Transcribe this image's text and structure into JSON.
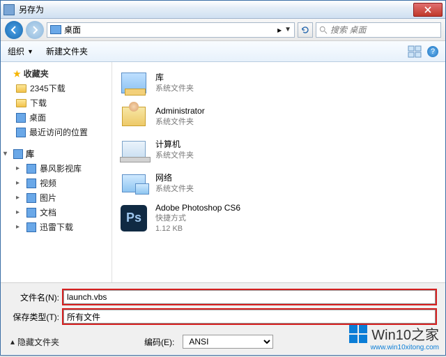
{
  "window": {
    "title": "另存为"
  },
  "nav": {
    "location": "桌面",
    "search_placeholder": "搜索 桌面"
  },
  "toolbar": {
    "organize": "组织",
    "new_folder": "新建文件夹"
  },
  "sidebar": {
    "favorites": {
      "label": "收藏夹",
      "items": [
        "2345下载",
        "下载",
        "桌面",
        "最近访问的位置"
      ]
    },
    "libraries": {
      "label": "库",
      "items": [
        "暴风影视库",
        "视频",
        "图片",
        "文档",
        "迅雷下载"
      ]
    }
  },
  "content": {
    "items": [
      {
        "title": "库",
        "subtitle": "系统文件夹"
      },
      {
        "title": "Administrator",
        "subtitle": "系统文件夹"
      },
      {
        "title": "计算机",
        "subtitle": "系统文件夹"
      },
      {
        "title": "网络",
        "subtitle": "系统文件夹"
      },
      {
        "title": "Adobe Photoshop CS6",
        "subtitle": "快捷方式",
        "size": "1.12 KB"
      }
    ]
  },
  "form": {
    "filename_label": "文件名(N):",
    "filename_value": "launch.vbs",
    "filetype_label": "保存类型(T):",
    "filetype_value": "所有文件"
  },
  "bottom": {
    "hide_folders": "隐藏文件夹",
    "encoding_label": "编码(E):",
    "encoding_value": "ANSI"
  },
  "watermark": {
    "text": "Win10之家",
    "url": "www.win10xitong.com"
  }
}
